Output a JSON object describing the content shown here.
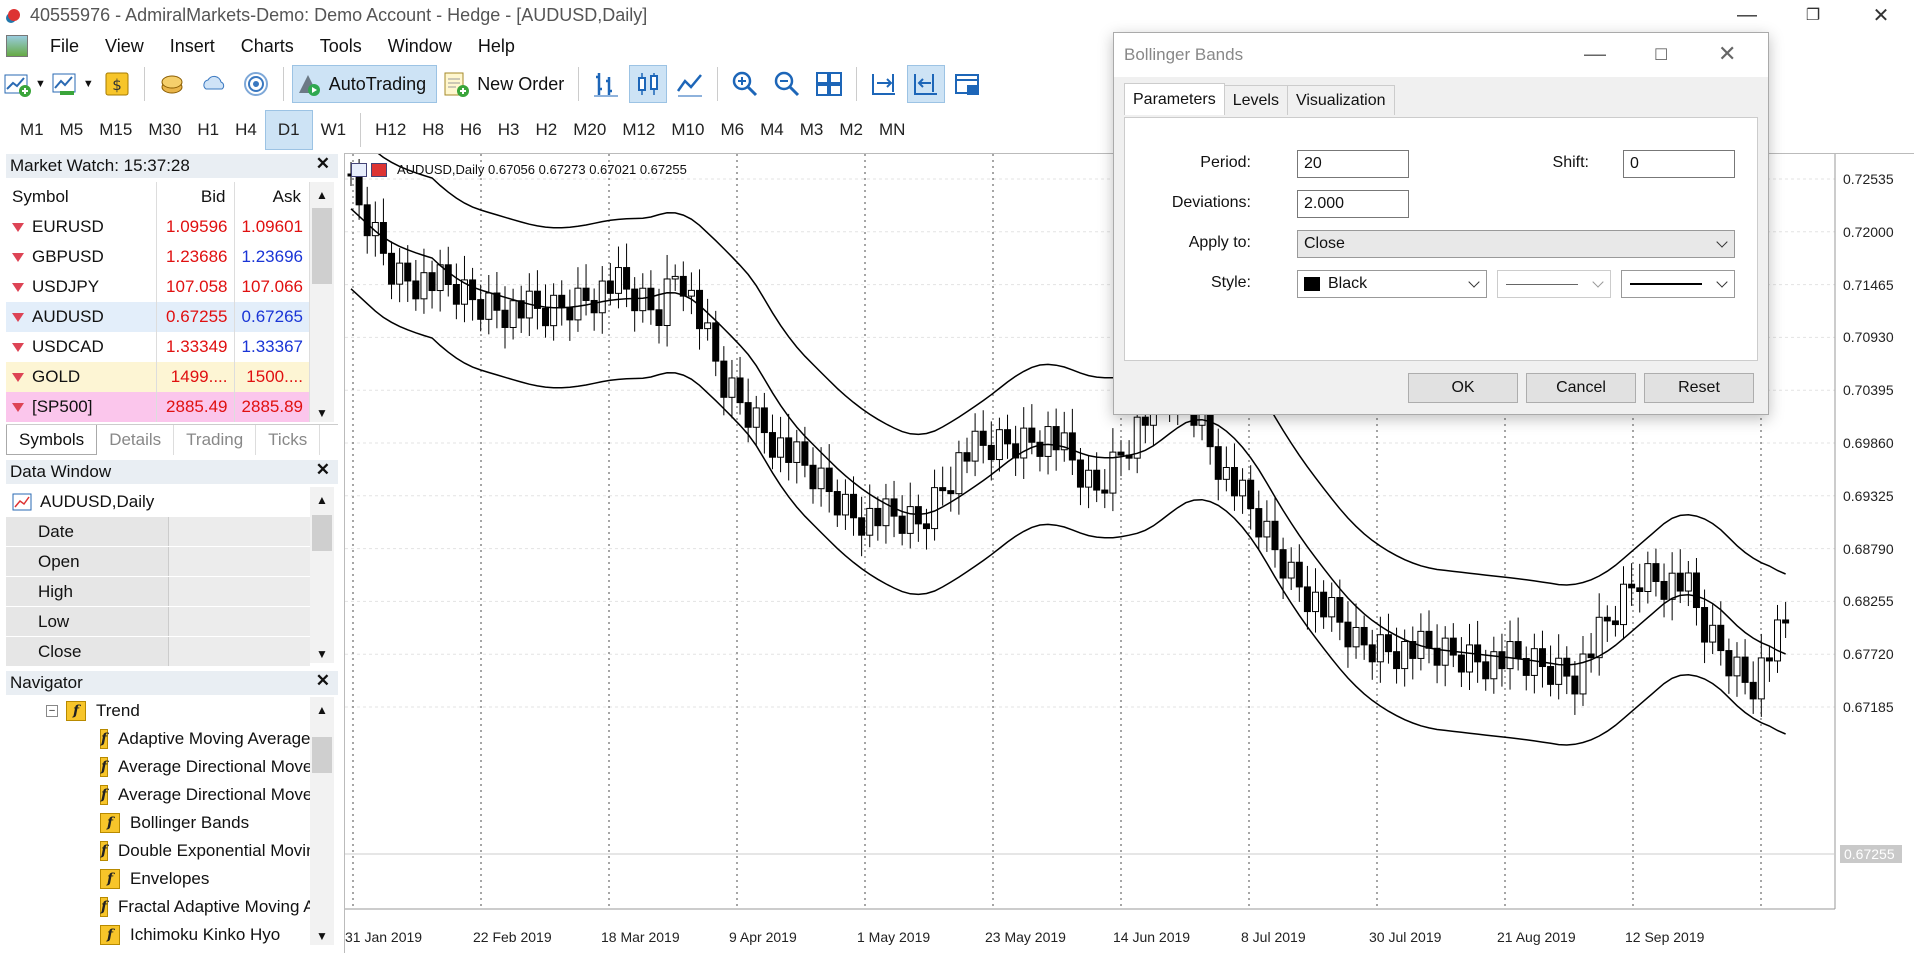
{
  "window": {
    "title": "40555976 - AdmiralMarkets-Demo: Demo Account - Hedge - [AUDUSD,Daily]"
  },
  "menu": [
    "File",
    "View",
    "Insert",
    "Charts",
    "Tools",
    "Window",
    "Help"
  ],
  "toolbar": {
    "autotrading": "AutoTrading",
    "new_order": "New Order"
  },
  "timeframes": [
    "M1",
    "M5",
    "M15",
    "M30",
    "H1",
    "H4",
    "D1",
    "W1",
    "H12",
    "H8",
    "H6",
    "H3",
    "H2",
    "M20",
    "M12",
    "M10",
    "M6",
    "M4",
    "M3",
    "M2",
    "MN"
  ],
  "active_timeframe": "D1",
  "market_watch": {
    "title": "Market Watch: 15:37:28",
    "headers": [
      "Symbol",
      "Bid",
      "Ask"
    ],
    "rows": [
      {
        "symbol": "EURUSD",
        "bid": "1.09596",
        "ask": "1.09601",
        "bid_color": "red",
        "ask_color": "red",
        "bg": "#ffffff"
      },
      {
        "symbol": "GBPUSD",
        "bid": "1.23686",
        "ask": "1.23696",
        "bid_color": "red",
        "ask_color": "blue",
        "bg": "#ffffff"
      },
      {
        "symbol": "USDJPY",
        "bid": "107.058",
        "ask": "107.066",
        "bid_color": "red",
        "ask_color": "red",
        "bg": "#ffffff"
      },
      {
        "symbol": "AUDUSD",
        "bid": "0.67255",
        "ask": "0.67265",
        "bid_color": "red",
        "ask_color": "blue",
        "bg": "#e3eefa"
      },
      {
        "symbol": "USDCAD",
        "bid": "1.33349",
        "ask": "1.33367",
        "bid_color": "red",
        "ask_color": "blue",
        "bg": "#ffffff"
      },
      {
        "symbol": "GOLD",
        "bid": "1499....",
        "ask": "1500....",
        "bid_color": "red",
        "ask_color": "red",
        "bg": "#fdf5d4"
      },
      {
        "symbol": "[SP500]",
        "bid": "2885.49",
        "ask": "2885.89",
        "bid_color": "red",
        "ask_color": "red",
        "bg": "#fbc6ec"
      }
    ],
    "tabs": [
      "Symbols",
      "Details",
      "Trading",
      "Ticks"
    ]
  },
  "data_window": {
    "title": "Data Window",
    "symbol": "AUDUSD,Daily",
    "rows": [
      "Date",
      "Open",
      "High",
      "Low",
      "Close"
    ]
  },
  "navigator": {
    "title": "Navigator",
    "group": "Trend",
    "items": [
      "Adaptive Moving Average",
      "Average Directional Movement Index",
      "Average Directional Movement Index Wilder",
      "Bollinger Bands",
      "Double Exponential Moving Average",
      "Envelopes",
      "Fractal Adaptive Moving Average",
      "Ichimoku Kinko Hyo"
    ]
  },
  "chart": {
    "header": "AUDUSD,Daily  0.67056 0.67273 0.67021 0.67255",
    "price_labels": [
      "0.72535",
      "0.72000",
      "0.71465",
      "0.70930",
      "0.70395",
      "0.69860",
      "0.69325",
      "0.68790",
      "0.68255",
      "0.67720",
      "0.67185"
    ],
    "current_price": "0.67255",
    "date_labels": [
      "31 Jan 2019",
      "22 Feb 2019",
      "18 Mar 2019",
      "9 Apr 2019",
      "1 May 2019",
      "23 May 2019",
      "14 Jun 2019",
      "8 Jul 2019",
      "30 Jul 2019",
      "21 Aug 2019",
      "12 Sep 2019"
    ]
  },
  "dialog": {
    "title": "Bollinger Bands",
    "tabs": [
      "Parameters",
      "Levels",
      "Visualization"
    ],
    "period_label": "Period:",
    "period": "20",
    "shift_label": "Shift:",
    "shift": "0",
    "deviations_label": "Deviations:",
    "deviations": "2.000",
    "apply_label": "Apply to:",
    "apply": "Close",
    "style_label": "Style:",
    "color": "Black",
    "ok": "OK",
    "cancel": "Cancel",
    "reset": "Reset"
  }
}
